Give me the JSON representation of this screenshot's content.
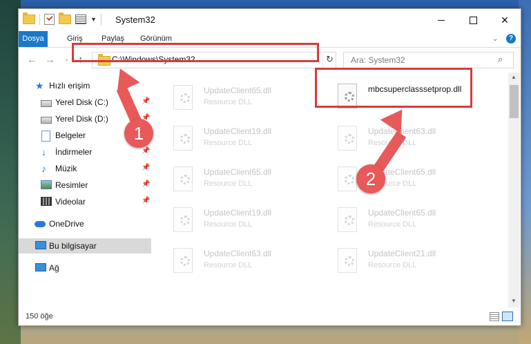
{
  "window": {
    "title": "System32",
    "colors": {
      "accent": "#1979ca",
      "annotation": "#e8595a",
      "highlight": "#d9393d"
    }
  },
  "ribbon": {
    "tabs": [
      "Dosya",
      "Giriş",
      "Paylaş",
      "Görünüm"
    ],
    "help": "?"
  },
  "nav": {
    "address": "C:\\Windows\\System32",
    "search_placeholder": "Ara: System32"
  },
  "sidebar": {
    "items": [
      {
        "label": "Hızlı erişim",
        "icon": "star-icon"
      },
      {
        "label": "Yerel Disk (C:)",
        "icon": "disk-icon",
        "pinned": true
      },
      {
        "label": "Yerel Disk (D:)",
        "icon": "disk-icon",
        "pinned": true
      },
      {
        "label": "Belgeler",
        "icon": "document-icon",
        "pinned": true
      },
      {
        "label": "İndirmeler",
        "icon": "download-icon",
        "pinned": true
      },
      {
        "label": "Müzik",
        "icon": "music-icon",
        "pinned": true
      },
      {
        "label": "Resimler",
        "icon": "pictures-icon",
        "pinned": true
      },
      {
        "label": "Videolar",
        "icon": "video-icon",
        "pinned": true
      },
      {
        "label": "OneDrive",
        "icon": "cloud-icon"
      },
      {
        "label": "Bu bilgisayar",
        "icon": "computer-icon",
        "selected": true
      },
      {
        "label": "Ağ",
        "icon": "network-icon"
      }
    ]
  },
  "files": {
    "highlighted": {
      "name": "mbcsuperclasssetprop.dll",
      "type": ""
    },
    "left": [
      {
        "name": "UpdateClient65.dll",
        "type": "Resource DLL"
      },
      {
        "name": "UpdateClient19.dll",
        "type": "Resource DLL"
      },
      {
        "name": "UpdateClient65.dll",
        "type": "Resource DLL"
      },
      {
        "name": "UpdateClient19.dll",
        "type": "Resource DLL"
      },
      {
        "name": "UpdateClient63.dll",
        "type": "Resource DLL"
      }
    ],
    "right": [
      {
        "name": "UpdateClient63.dll",
        "type": "Resource DLL"
      },
      {
        "name": "UpdateClient65.dll",
        "type": "Resource DLL"
      },
      {
        "name": "UpdateClient65.dll",
        "type": "Resource DLL"
      },
      {
        "name": "UpdateClient21.dll",
        "type": "Resource DLL"
      }
    ]
  },
  "status": {
    "item_count": "150 öğe"
  },
  "annotations": {
    "step1": "1",
    "step2": "2"
  }
}
